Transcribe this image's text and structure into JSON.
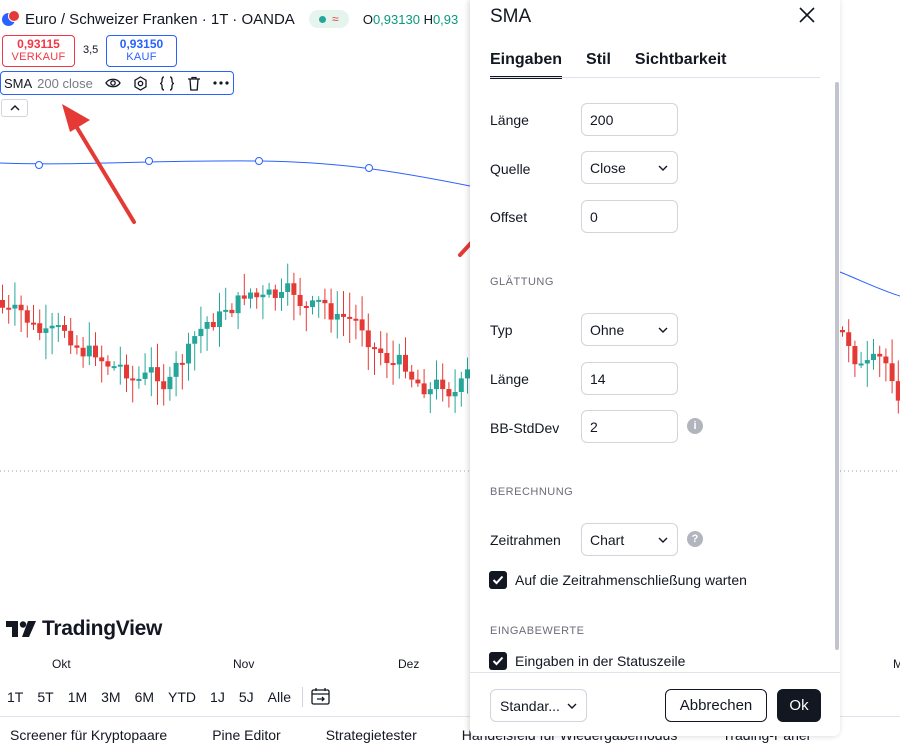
{
  "symbol": {
    "title": "Euro / Schweizer Franken · 1T · OANDA",
    "status_wave": "≈",
    "ohlc_o_label": "O",
    "ohlc_o_value": "0,93130",
    "ohlc_h_label": "H",
    "ohlc_h_value": "0,93"
  },
  "trade": {
    "sell_price": "0,93115",
    "sell_label": "VERKAUF",
    "spread": "3,5",
    "buy_price": "0,93150",
    "buy_label": "KAUF"
  },
  "indicator": {
    "name": "SMA",
    "args": "200 close",
    "icons": [
      "eye-icon",
      "settings-icon",
      "source-code-icon",
      "trash-icon",
      "more-icon"
    ]
  },
  "branding": {
    "logo_text": "TradingView"
  },
  "x_axis_months": [
    "Okt",
    "Nov",
    "Dez",
    "M"
  ],
  "timeframes": [
    "1T",
    "5T",
    "1M",
    "3M",
    "6M",
    "YTD",
    "1J",
    "5J",
    "Alle"
  ],
  "bottom_tabs": [
    "Screener für Kryptopaare",
    "Pine Editor",
    "Strategietester",
    "Handelsfeld für Wiedergabemodus",
    "Trading-Panel"
  ],
  "dialog": {
    "title": "SMA",
    "tabs": [
      "Eingaben",
      "Stil",
      "Sichtbarkeit"
    ],
    "inputs": {
      "length_label": "Länge",
      "length_value": "200",
      "source_label": "Quelle",
      "source_value": "Close",
      "offset_label": "Offset",
      "offset_value": "0"
    },
    "smoothing": {
      "section": "GLÄTTUNG",
      "type_label": "Typ",
      "type_value": "Ohne",
      "length_label": "Länge",
      "length_value": "14",
      "bb_label": "BB-StdDev",
      "bb_value": "2"
    },
    "calculation": {
      "section": "BERECHNUNG",
      "timeframe_label": "Zeitrahmen",
      "timeframe_value": "Chart",
      "wait_close_label": "Auf die Zeitrahmenschließung warten"
    },
    "input_values": {
      "section": "EINGABEWERTE",
      "statusline_label": "Eingaben in der Statuszeile"
    },
    "footer": {
      "preset": "Standar...",
      "cancel": "Abbrechen",
      "ok": "Ok"
    }
  },
  "colors": {
    "up_candle": "#26a69a",
    "down_candle": "#e53935",
    "sma_line": "#2962ff",
    "annotation_arrow": "#e53935",
    "accent": "#131722"
  }
}
